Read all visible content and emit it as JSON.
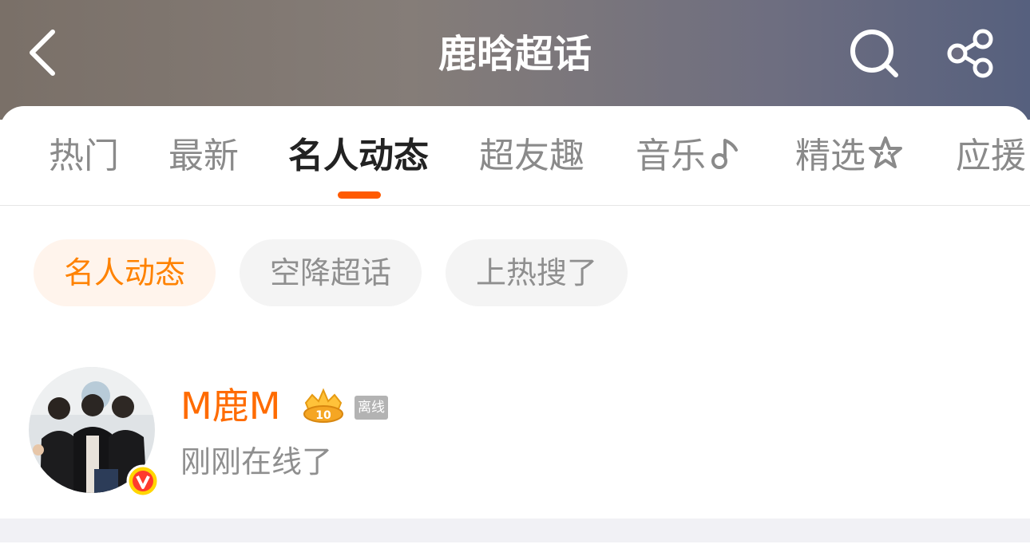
{
  "header": {
    "title": "鹿晗超话",
    "back_icon": "back-chevron-icon",
    "search_icon": "search-icon",
    "share_icon": "share-icon",
    "gradient": [
      "#7a7068",
      "#56607e"
    ]
  },
  "tabs": [
    {
      "label": "热门",
      "active": false
    },
    {
      "label": "最新",
      "active": false
    },
    {
      "label": "名人动态",
      "active": true
    },
    {
      "label": "超友趣",
      "active": false
    },
    {
      "label": "音乐",
      "icon": "music-note-icon",
      "active": false
    },
    {
      "label": "精选",
      "icon": "star-icon",
      "active": false
    },
    {
      "label": "应援",
      "active": false
    }
  ],
  "chips": [
    {
      "label": "名人动态",
      "active": true
    },
    {
      "label": "空降超话",
      "active": false
    },
    {
      "label": "上热搜了",
      "active": false
    }
  ],
  "user": {
    "name": "M鹿M",
    "crown_level": "10",
    "status_badge": "离线",
    "subtitle": "刚刚在线了",
    "verified_icon": "verified-v-icon"
  },
  "colors": {
    "accent": "#ff5a00",
    "name": "#ff6b00",
    "chip_active_bg": "#fff4ec",
    "chip_active_text": "#ff8200"
  }
}
